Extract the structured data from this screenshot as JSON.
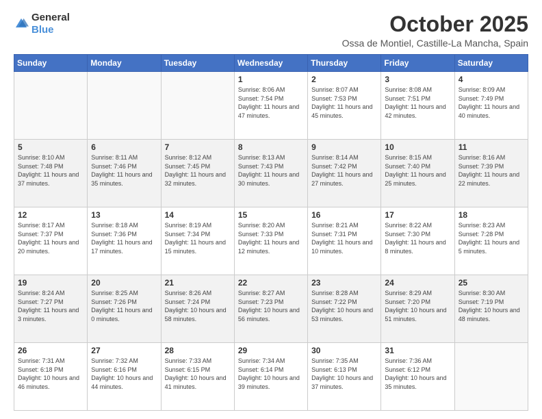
{
  "logo": {
    "general": "General",
    "blue": "Blue"
  },
  "header": {
    "month": "October 2025",
    "location": "Ossa de Montiel, Castille-La Mancha, Spain"
  },
  "weekdays": [
    "Sunday",
    "Monday",
    "Tuesday",
    "Wednesday",
    "Thursday",
    "Friday",
    "Saturday"
  ],
  "weeks": [
    [
      {
        "day": "",
        "info": ""
      },
      {
        "day": "",
        "info": ""
      },
      {
        "day": "",
        "info": ""
      },
      {
        "day": "1",
        "info": "Sunrise: 8:06 AM\nSunset: 7:54 PM\nDaylight: 11 hours and 47 minutes."
      },
      {
        "day": "2",
        "info": "Sunrise: 8:07 AM\nSunset: 7:53 PM\nDaylight: 11 hours and 45 minutes."
      },
      {
        "day": "3",
        "info": "Sunrise: 8:08 AM\nSunset: 7:51 PM\nDaylight: 11 hours and 42 minutes."
      },
      {
        "day": "4",
        "info": "Sunrise: 8:09 AM\nSunset: 7:49 PM\nDaylight: 11 hours and 40 minutes."
      }
    ],
    [
      {
        "day": "5",
        "info": "Sunrise: 8:10 AM\nSunset: 7:48 PM\nDaylight: 11 hours and 37 minutes."
      },
      {
        "day": "6",
        "info": "Sunrise: 8:11 AM\nSunset: 7:46 PM\nDaylight: 11 hours and 35 minutes."
      },
      {
        "day": "7",
        "info": "Sunrise: 8:12 AM\nSunset: 7:45 PM\nDaylight: 11 hours and 32 minutes."
      },
      {
        "day": "8",
        "info": "Sunrise: 8:13 AM\nSunset: 7:43 PM\nDaylight: 11 hours and 30 minutes."
      },
      {
        "day": "9",
        "info": "Sunrise: 8:14 AM\nSunset: 7:42 PM\nDaylight: 11 hours and 27 minutes."
      },
      {
        "day": "10",
        "info": "Sunrise: 8:15 AM\nSunset: 7:40 PM\nDaylight: 11 hours and 25 minutes."
      },
      {
        "day": "11",
        "info": "Sunrise: 8:16 AM\nSunset: 7:39 PM\nDaylight: 11 hours and 22 minutes."
      }
    ],
    [
      {
        "day": "12",
        "info": "Sunrise: 8:17 AM\nSunset: 7:37 PM\nDaylight: 11 hours and 20 minutes."
      },
      {
        "day": "13",
        "info": "Sunrise: 8:18 AM\nSunset: 7:36 PM\nDaylight: 11 hours and 17 minutes."
      },
      {
        "day": "14",
        "info": "Sunrise: 8:19 AM\nSunset: 7:34 PM\nDaylight: 11 hours and 15 minutes."
      },
      {
        "day": "15",
        "info": "Sunrise: 8:20 AM\nSunset: 7:33 PM\nDaylight: 11 hours and 12 minutes."
      },
      {
        "day": "16",
        "info": "Sunrise: 8:21 AM\nSunset: 7:31 PM\nDaylight: 11 hours and 10 minutes."
      },
      {
        "day": "17",
        "info": "Sunrise: 8:22 AM\nSunset: 7:30 PM\nDaylight: 11 hours and 8 minutes."
      },
      {
        "day": "18",
        "info": "Sunrise: 8:23 AM\nSunset: 7:28 PM\nDaylight: 11 hours and 5 minutes."
      }
    ],
    [
      {
        "day": "19",
        "info": "Sunrise: 8:24 AM\nSunset: 7:27 PM\nDaylight: 11 hours and 3 minutes."
      },
      {
        "day": "20",
        "info": "Sunrise: 8:25 AM\nSunset: 7:26 PM\nDaylight: 11 hours and 0 minutes."
      },
      {
        "day": "21",
        "info": "Sunrise: 8:26 AM\nSunset: 7:24 PM\nDaylight: 10 hours and 58 minutes."
      },
      {
        "day": "22",
        "info": "Sunrise: 8:27 AM\nSunset: 7:23 PM\nDaylight: 10 hours and 56 minutes."
      },
      {
        "day": "23",
        "info": "Sunrise: 8:28 AM\nSunset: 7:22 PM\nDaylight: 10 hours and 53 minutes."
      },
      {
        "day": "24",
        "info": "Sunrise: 8:29 AM\nSunset: 7:20 PM\nDaylight: 10 hours and 51 minutes."
      },
      {
        "day": "25",
        "info": "Sunrise: 8:30 AM\nSunset: 7:19 PM\nDaylight: 10 hours and 48 minutes."
      }
    ],
    [
      {
        "day": "26",
        "info": "Sunrise: 7:31 AM\nSunset: 6:18 PM\nDaylight: 10 hours and 46 minutes."
      },
      {
        "day": "27",
        "info": "Sunrise: 7:32 AM\nSunset: 6:16 PM\nDaylight: 10 hours and 44 minutes."
      },
      {
        "day": "28",
        "info": "Sunrise: 7:33 AM\nSunset: 6:15 PM\nDaylight: 10 hours and 41 minutes."
      },
      {
        "day": "29",
        "info": "Sunrise: 7:34 AM\nSunset: 6:14 PM\nDaylight: 10 hours and 39 minutes."
      },
      {
        "day": "30",
        "info": "Sunrise: 7:35 AM\nSunset: 6:13 PM\nDaylight: 10 hours and 37 minutes."
      },
      {
        "day": "31",
        "info": "Sunrise: 7:36 AM\nSunset: 6:12 PM\nDaylight: 10 hours and 35 minutes."
      },
      {
        "day": "",
        "info": ""
      }
    ]
  ]
}
